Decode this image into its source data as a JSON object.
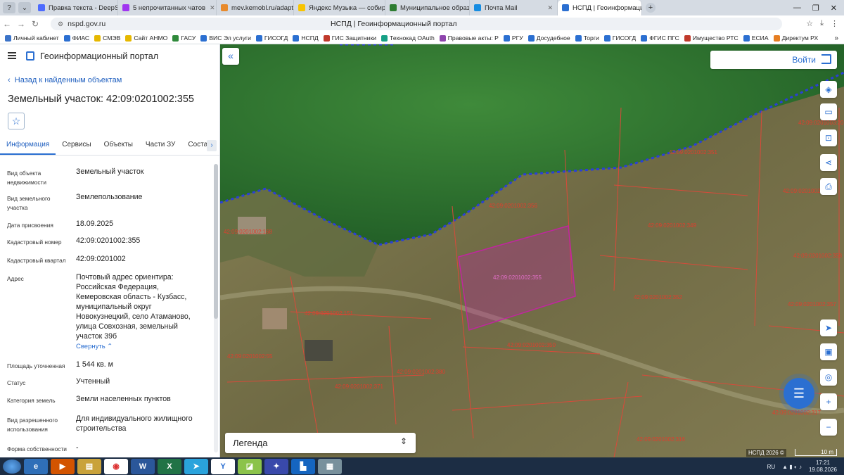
{
  "browser": {
    "tabs": [
      {
        "label": "Правка текста - DeepSeek",
        "color": "#4d6bfe"
      },
      {
        "label": "5 непрочитанных чатов",
        "color": "#a035f0"
      },
      {
        "label": "mev.kemobl.ru/adapter-w",
        "color": "#e88a2c"
      },
      {
        "label": "Яндекс Музыка — собира",
        "color": "#f8c400"
      },
      {
        "label": "Муниципальное образов",
        "color": "#2e7d32"
      },
      {
        "label": "Почта Mail",
        "color": "#168de2"
      },
      {
        "label": "НСПД | Геоинформацио",
        "color": "#2b6fd1",
        "active": true
      }
    ],
    "url": "nspd.gov.ru",
    "page_title": "НСПД | Геоинформационный портал",
    "bookmarks": [
      {
        "label": "Личный кабинет",
        "color": "#3b73c8"
      },
      {
        "label": "ФИАС",
        "color": "#2b6fd1"
      },
      {
        "label": "СМЭВ",
        "color": "#e6b800"
      },
      {
        "label": "Сайт АНМО",
        "color": "#e6b800"
      },
      {
        "label": "ГАСУ",
        "color": "#2f8a3b"
      },
      {
        "label": "ВИС Эл услуги",
        "color": "#2b6fd1"
      },
      {
        "label": "ГИСОГД",
        "color": "#2b6fd1"
      },
      {
        "label": "НСПД",
        "color": "#2b6fd1"
      },
      {
        "label": "ГИС Защитники",
        "color": "#c0392b"
      },
      {
        "label": "Технокад OAuth",
        "color": "#16a085"
      },
      {
        "label": "Правовые акты: Р",
        "color": "#8e44ad"
      },
      {
        "label": "РГУ",
        "color": "#2b6fd1"
      },
      {
        "label": "Досудебное",
        "color": "#2b6fd1"
      },
      {
        "label": "Торги",
        "color": "#2b6fd1"
      },
      {
        "label": "ГИСОГД",
        "color": "#2b6fd1"
      },
      {
        "label": "ФГИС ПГС",
        "color": "#2b6fd1"
      },
      {
        "label": "Имущество РТС",
        "color": "#c0392b"
      },
      {
        "label": "ЕСИА",
        "color": "#2b6fd1"
      },
      {
        "label": "Директум РХ",
        "color": "#e67e22"
      }
    ]
  },
  "panel": {
    "title": "Геоинформационный портал",
    "back": "Назад к найденным объектам",
    "object_title": "Земельный участок: 42:09:0201002:355",
    "tabs": [
      "Информация",
      "Сервисы",
      "Объекты",
      "Части ЗУ",
      "Состав"
    ],
    "fields": [
      {
        "label": "Вид объекта недвижимости",
        "value": "Земельный участок"
      },
      {
        "label": "Вид земельного участка",
        "value": "Землепользование"
      },
      {
        "label": "Дата присвоения",
        "value": "18.09.2025"
      },
      {
        "label": "Кадастровый номер",
        "value": "42:09:0201002:355"
      },
      {
        "label": "Кадастровый квартал",
        "value": "42:09:0201002"
      },
      {
        "label": "Адрес",
        "value": "Почтовый адрес ориентира: Российская Федерация, Кемеровская область - Кузбасс, муниципальный округ Новокузнецкий, село Атаманово, улица Совхозная, земельный участок 39б"
      },
      {
        "label": "Площадь уточненная",
        "value": "1 544 кв. м"
      },
      {
        "label": "Статус",
        "value": "Учтенный"
      },
      {
        "label": "Категория земель",
        "value": "Земли населенных пунктов"
      },
      {
        "label": "Вид разрешенного использования",
        "value": "Для индивидуального жилищного строительства"
      },
      {
        "label": "Форма собственности",
        "value": "-"
      }
    ],
    "collapse": "Свернуть"
  },
  "map": {
    "login": "Войти",
    "legend": "Легенда",
    "attribution": "НСПД 2026 ©",
    "scale": "10 m",
    "parcels": [
      "42:09:0201003:20",
      "42:09:0201002:351",
      "42:09:0201002:349",
      "42:09:0201002:356",
      "42:09:0201002:168",
      "42:09:0201002:355",
      "42:09:0201002:352",
      "42:09:0201002:151",
      "42:09:0201002:350",
      "42:09:0201002:55",
      "42:09:0201002:380",
      "42:09:0201002:371",
      "42:09:0201002:357",
      "42:09:0201002:358",
      "42:09:0201002:317",
      "42:09:0201002:316",
      "42:09:0201002:35"
    ],
    "controls": [
      "layers-icon",
      "ruler-icon",
      "select-area-icon",
      "share-icon",
      "print-icon",
      "navigate-icon",
      "minimap-icon",
      "locate-icon",
      "zoom-in-icon",
      "zoom-out-icon"
    ],
    "accent": "#2b6fd1",
    "highlight": "#c0269f"
  },
  "taskbar": {
    "lang": "RU",
    "time": "17:21",
    "date": "19.08.2026"
  }
}
